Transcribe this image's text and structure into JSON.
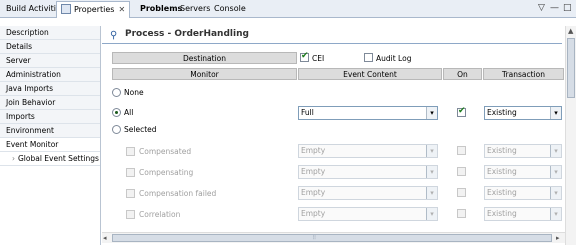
{
  "tabs": [
    {
      "label": "Build Activities",
      "active": false
    },
    {
      "label": "Properties",
      "active": true
    },
    {
      "label": "Problems",
      "active": false,
      "bold": true
    },
    {
      "label": "Servers",
      "active": false
    },
    {
      "label": "Console",
      "active": false
    }
  ],
  "window_controls": {
    "menu": "▽",
    "minimize": "—",
    "maximize": "□"
  },
  "nav": {
    "items": [
      "Description",
      "Details",
      "Server",
      "Administration",
      "Java Imports",
      "Join Behavior",
      "Imports",
      "Environment",
      "Event Monitor"
    ],
    "selected": "Event Monitor",
    "subitem": "Global Event Settings",
    "sub_marker": "›"
  },
  "process": {
    "title": "Process - OrderHandling"
  },
  "destination": {
    "header": "Destination",
    "cei_label": "CEI",
    "cei_checked": true,
    "audit_label": "Audit Log",
    "audit_checked": false
  },
  "columns": {
    "monitor": "Monitor",
    "event_content": "Event Content",
    "on": "On",
    "transaction": "Transaction"
  },
  "options": {
    "none": "None",
    "all": "All",
    "selected": "Selected",
    "selected_value": "All"
  },
  "all_row": {
    "event_content": "Full",
    "on": true,
    "transaction": "Existing"
  },
  "events": [
    {
      "label": "Compensated",
      "content": "Empty",
      "transaction": "Existing"
    },
    {
      "label": "Compensating",
      "content": "Empty",
      "transaction": "Existing"
    },
    {
      "label": "Compensation failed",
      "content": "Empty",
      "transaction": "Existing"
    },
    {
      "label": "Correlation",
      "content": "Empty",
      "transaction": "Existing"
    }
  ],
  "icons": {
    "dropdown": "▾",
    "scroll_up": "▲",
    "scroll_left": "◂",
    "scroll_right": "▸",
    "scroll_grip": "⦙⦙"
  }
}
